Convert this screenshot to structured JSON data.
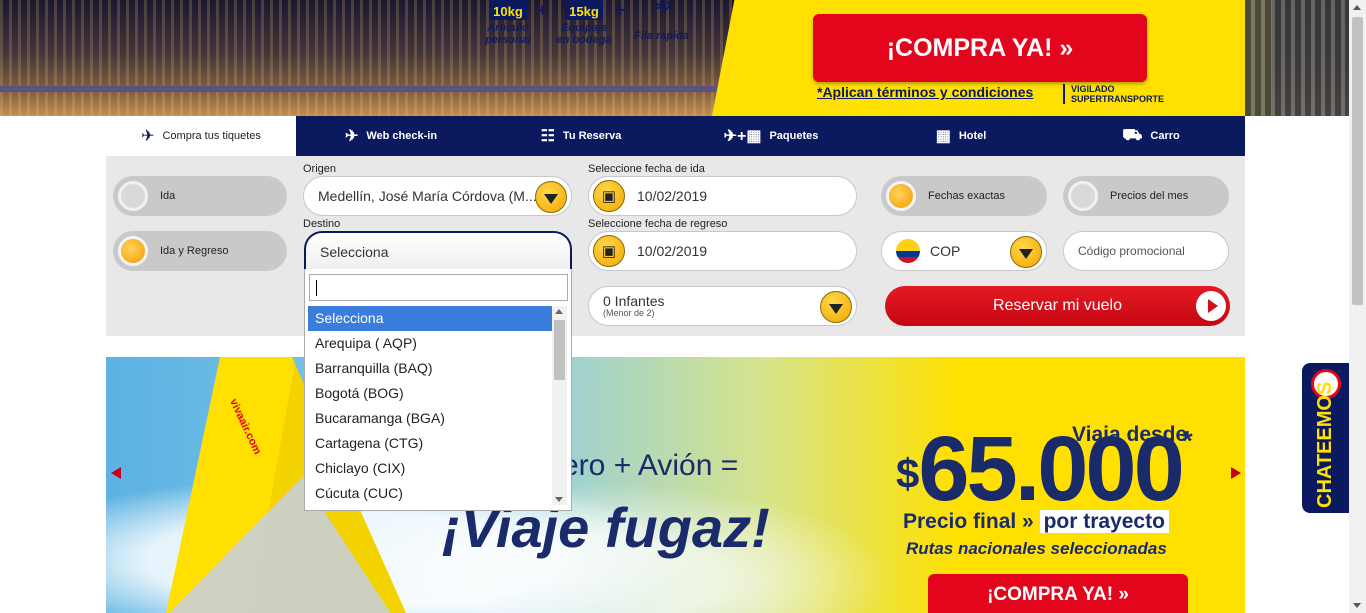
{
  "hero": {
    "perks": [
      {
        "badge": "10kg",
        "label": "Artículo personal"
      },
      {
        "badge": "15kg",
        "label": "Equipaje en bodega"
      },
      {
        "badge": "",
        "label": "Fila rápida"
      }
    ],
    "buy_button": "¡COMPRA YA!  »",
    "terms_link": "*Aplican términos y condiciones",
    "vigilado": "VIGILADO SUPERTRANSPORTE"
  },
  "tabs": [
    {
      "label": "Compra tus tiquetes",
      "icon": "plane-sun-icon"
    },
    {
      "label": "Web check-in",
      "icon": "plane-checkin-icon"
    },
    {
      "label": "Tu Reserva",
      "icon": "reservation-icon"
    },
    {
      "label": "Paquetes",
      "icon": "plane-hotel-icon"
    },
    {
      "label": "Hotel",
      "icon": "building-icon"
    },
    {
      "label": "Carro",
      "icon": "car-icon"
    }
  ],
  "trip_type": {
    "one_way": "Ida",
    "round_trip": "Ida y Regreso",
    "selected": "Ida y Regreso"
  },
  "origin": {
    "label": "Origen",
    "value": "Medellín, José María Córdova (M..."
  },
  "destination": {
    "label": "Destino",
    "value": "Selecciona",
    "search_value": "",
    "options": [
      "Selecciona",
      "Arequipa ( AQP)",
      "Barranquilla (BAQ)",
      "Bogotá (BOG)",
      "Bucaramanga (BGA)",
      "Cartagena (CTG)",
      "Chiclayo (CIX)",
      "Cúcuta (CUC)"
    ],
    "highlighted": "Selecciona"
  },
  "dates": {
    "depart_label": "Seleccione fecha de ida",
    "depart_value": "10/02/2019",
    "return_label": "Seleccione fecha de regreso",
    "return_value": "10/02/2019"
  },
  "infants": {
    "value": "0 Infantes",
    "hint": "(Menor de 2)"
  },
  "date_mode": {
    "exact": "Fechas exactas",
    "month_prices": "Precios del mes",
    "selected": "Fechas exactas"
  },
  "currency": {
    "value": "COP"
  },
  "promo_code": {
    "placeholder": "Código promocional"
  },
  "reserve_button": "Reservar mi vuelo",
  "promo": {
    "airline_mark": "vivaair.com",
    "slogan_line1": "ero + Avión =",
    "slogan_line2": "¡Viaje fugaz!",
    "from_label": "Viaja desde",
    "currency_symbol": "$",
    "price": "65.000",
    "asterisk": "*",
    "final_label": "Precio final »",
    "final_highlight": "por trayecto",
    "routes": "Rutas nacionales seleccionadas",
    "cta": "¡COMPRA YA!  »"
  },
  "chat": {
    "label": "CHATEEMOS"
  },
  "colors": {
    "navy": "#0b1a5e",
    "brand_yellow": "#ffe000",
    "brand_red": "#e3051b",
    "highlight_blue": "#3b7ddd"
  }
}
